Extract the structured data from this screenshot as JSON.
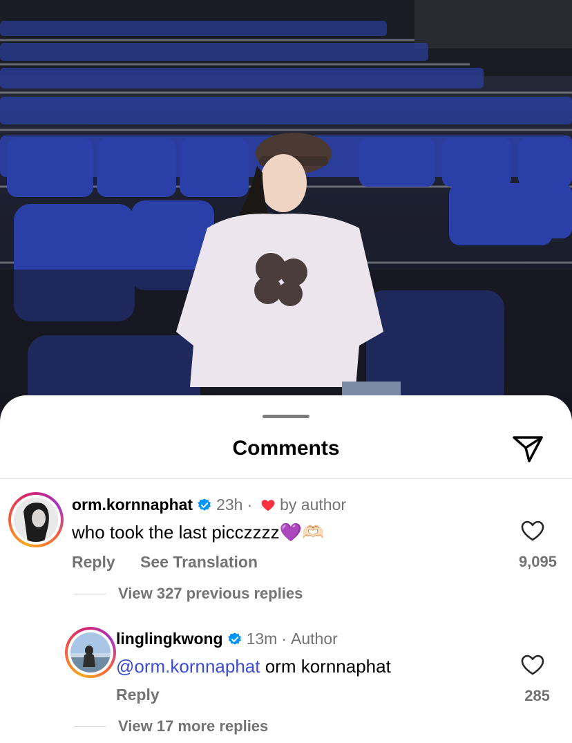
{
  "sheet": {
    "title": "Comments"
  },
  "comments": [
    {
      "username": "orm.kornnaphat",
      "time": "23h",
      "separator": "·",
      "liked_by_author": "by author",
      "text": "who took the last picczzzz",
      "emoji": "💜🫶🏻",
      "reply_label": "Reply",
      "see_translation_label": "See Translation",
      "like_count": "9,095",
      "view_replies_label": "View 327 previous replies"
    },
    {
      "username": "linglingkwong",
      "time": "13m",
      "separator": "·",
      "author_badge": "Author",
      "mention": "@orm.kornnaphat",
      "text": " orm kornnaphat",
      "reply_label": "Reply",
      "like_count": "285",
      "view_replies_label": "View 17 more replies"
    }
  ],
  "colors": {
    "verified_blue": "#0095f6",
    "heart_red": "#ff3040",
    "mention_blue": "#3a4bd6",
    "muted_text": "#737373"
  },
  "icons": {
    "share": "paper-plane-icon",
    "verified": "verified-badge-icon",
    "like": "heart-outline-icon",
    "liked_by_author": "heart-filled-icon"
  }
}
